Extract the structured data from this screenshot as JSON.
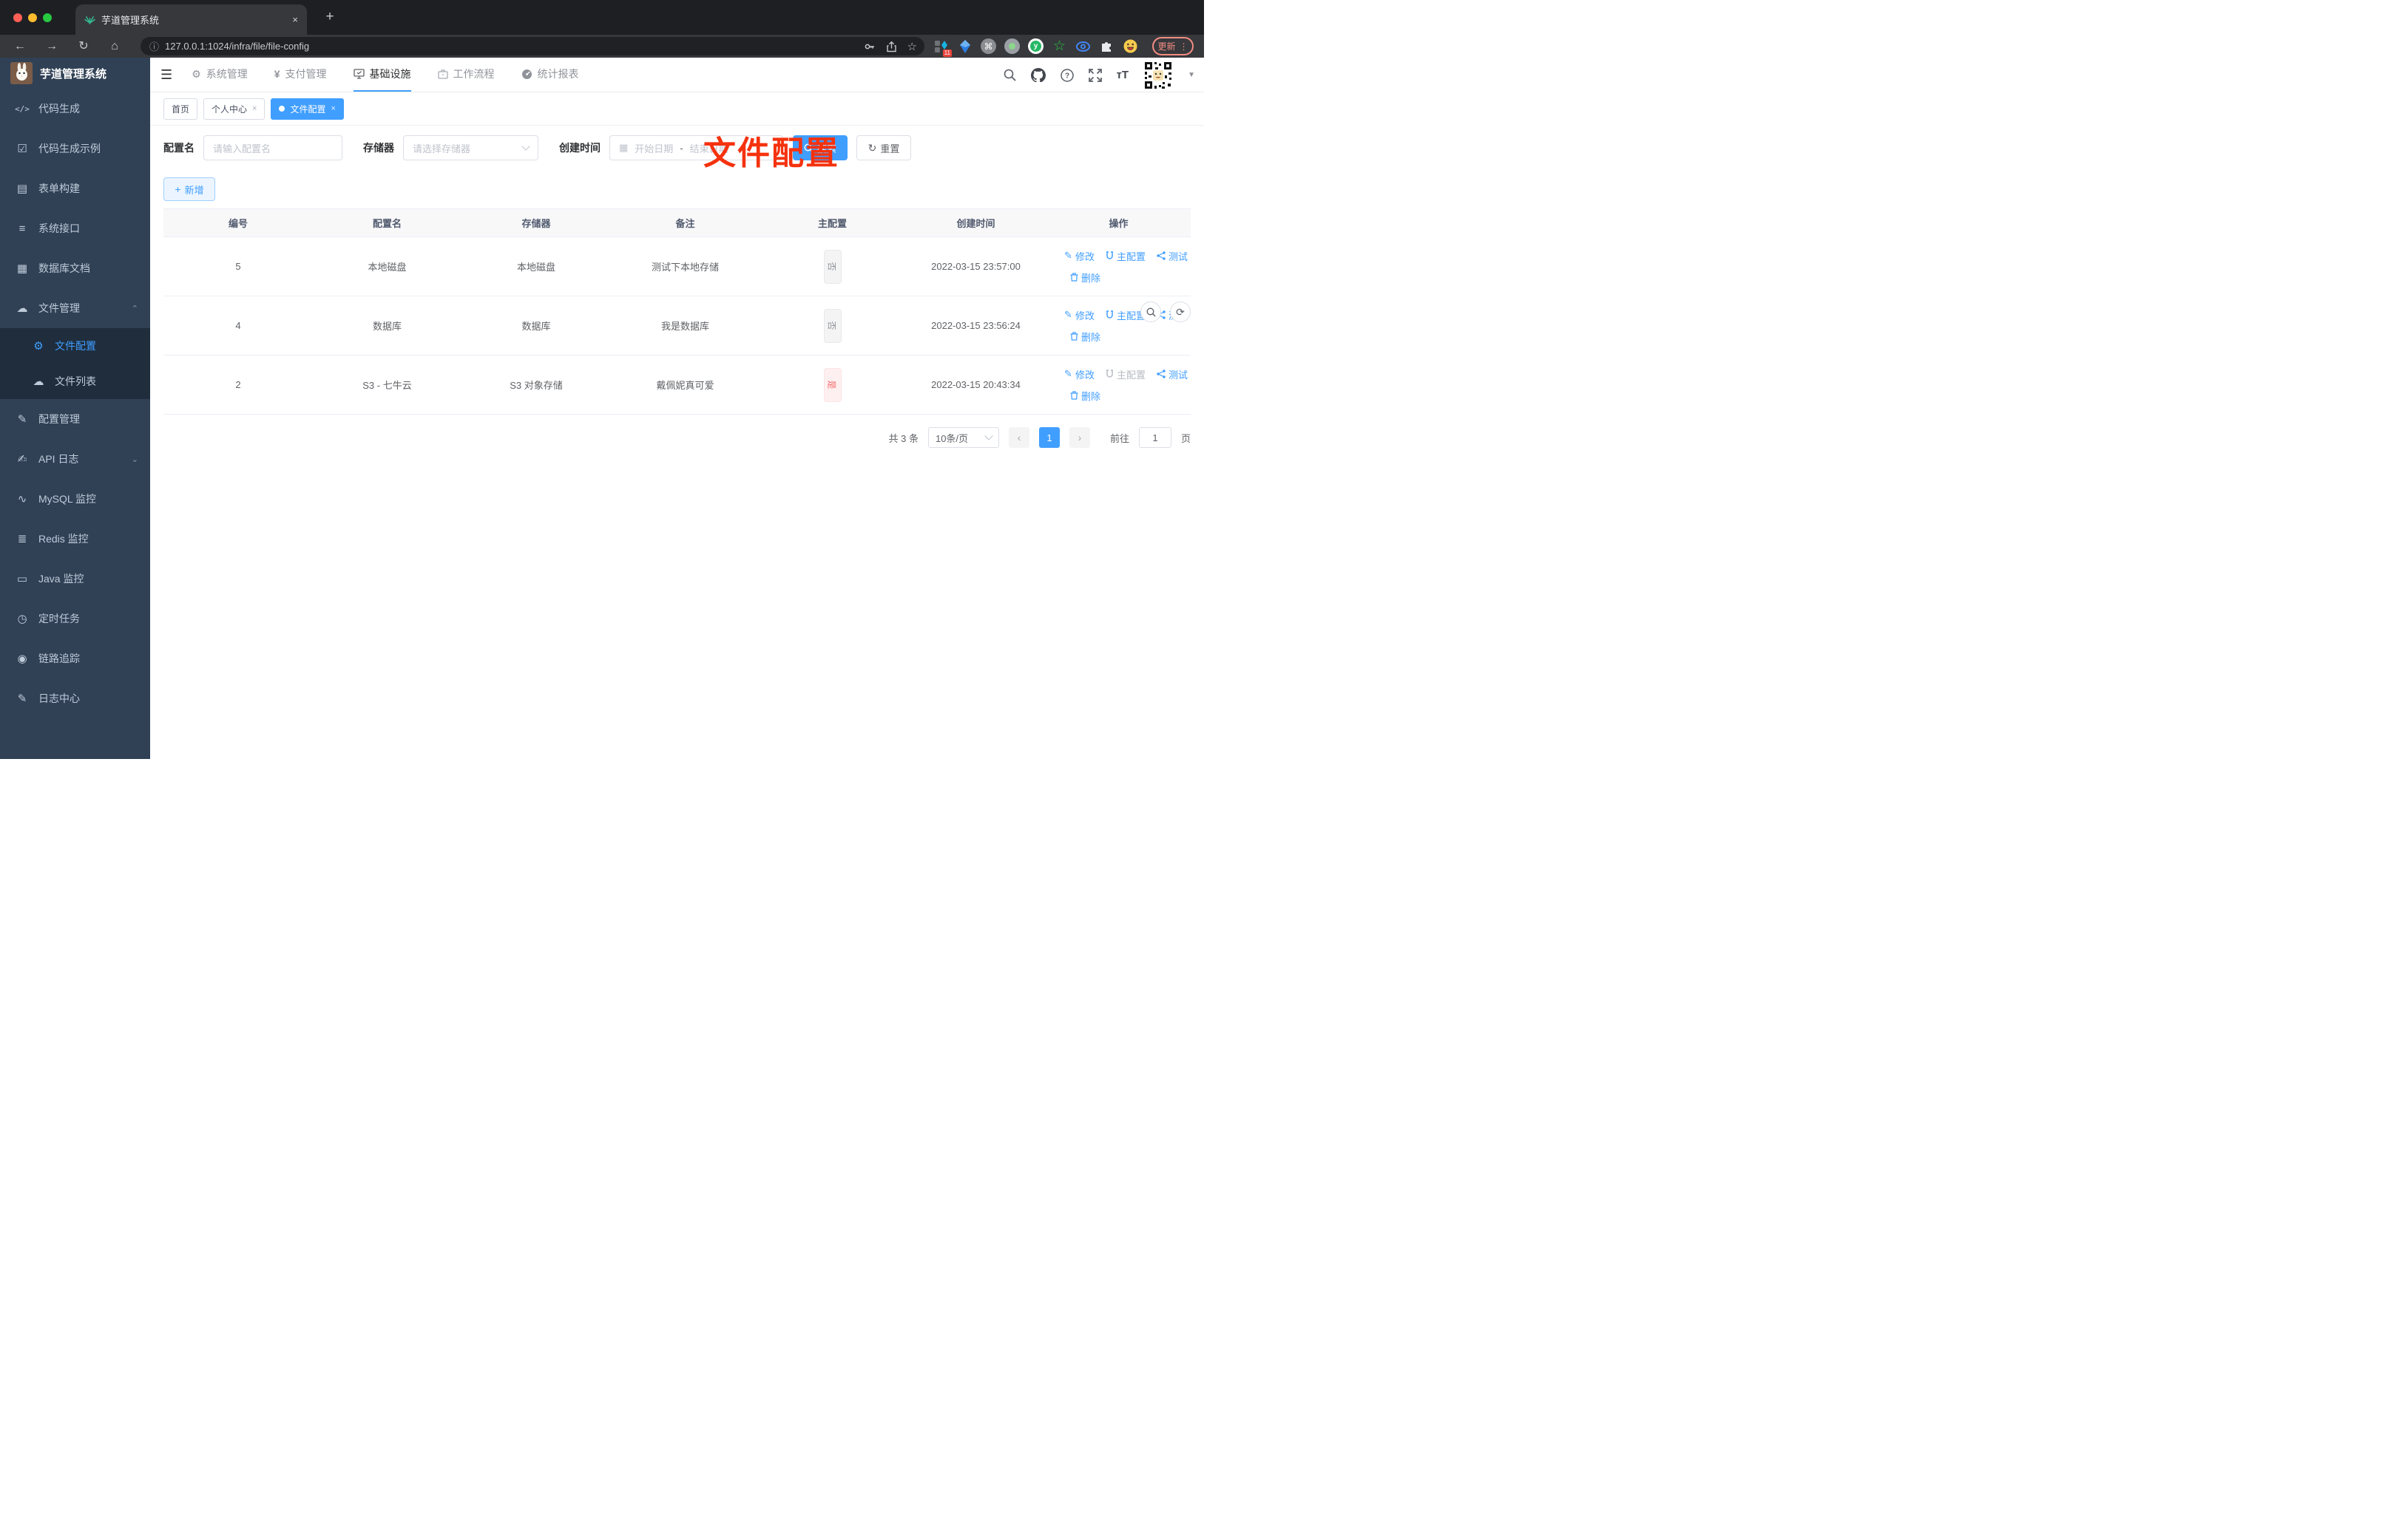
{
  "browser": {
    "tab_title": "芋道管理系统",
    "new_tab": "+",
    "close_tab": "×",
    "url": "127.0.0.1:1024/infra/file/file-config",
    "extension_badge": "11",
    "update_button": "更新"
  },
  "app": {
    "logo_title": "芋道管理系统",
    "top_nav": [
      {
        "label": "系统管理",
        "icon": "⚙"
      },
      {
        "label": "支付管理",
        "icon": "¥"
      },
      {
        "label": "基础设施",
        "icon": ""
      },
      {
        "label": "工作流程",
        "icon": ""
      },
      {
        "label": "统计报表",
        "icon": ""
      }
    ]
  },
  "sidebar": {
    "items": [
      {
        "label": "代码生成",
        "icon": "</>"
      },
      {
        "label": "代码生成示例",
        "icon": "☑"
      },
      {
        "label": "表单构建",
        "icon": "▤"
      },
      {
        "label": "系统接口",
        "icon": "≡"
      },
      {
        "label": "数据库文档",
        "icon": "▦"
      },
      {
        "label": "文件管理",
        "icon": "☁"
      },
      {
        "label": "文件配置",
        "icon": "⚙"
      },
      {
        "label": "文件列表",
        "icon": "☁"
      },
      {
        "label": "配置管理",
        "icon": "✎"
      },
      {
        "label": "API 日志",
        "icon": "✍"
      },
      {
        "label": "MySQL 监控",
        "icon": "∿"
      },
      {
        "label": "Redis 监控",
        "icon": "≣"
      },
      {
        "label": "Java 监控",
        "icon": "▭"
      },
      {
        "label": "定时任务",
        "icon": "◷"
      },
      {
        "label": "链路追踪",
        "icon": "◉"
      },
      {
        "label": "日志中心",
        "icon": "✎"
      }
    ]
  },
  "tabs": [
    {
      "label": "首页"
    },
    {
      "label": "个人中心",
      "close": "×"
    },
    {
      "label": "文件配置",
      "close": "×"
    }
  ],
  "annotation": "文件配置",
  "filter": {
    "name_label": "配置名",
    "name_placeholder": "请输入配置名",
    "storage_label": "存储器",
    "storage_placeholder": "请选择存储器",
    "time_label": "创建时间",
    "start_placeholder": "开始日期",
    "separator": "-",
    "end_placeholder": "结束日期",
    "search_label": "搜索",
    "reset_label": "重置"
  },
  "toolbar": {
    "add_label": "新增"
  },
  "table": {
    "headers": [
      "编号",
      "配置名",
      "存储器",
      "备注",
      "主配置",
      "创建时间",
      "操作"
    ],
    "actions": {
      "edit": "修改",
      "master": "主配置",
      "test": "测试",
      "delete": "删除"
    },
    "rows": [
      {
        "id": "5",
        "name": "本地磁盘",
        "storage": "本地磁盘",
        "remark": "测试下本地存储",
        "master": "否",
        "master_type": "info",
        "time": "2022-03-15 23:57:00",
        "master_action_disabled": false
      },
      {
        "id": "4",
        "name": "数据库",
        "storage": "数据库",
        "remark": "我是数据库",
        "master": "否",
        "master_type": "info",
        "time": "2022-03-15 23:56:24",
        "master_action_disabled": false
      },
      {
        "id": "2",
        "name": "S3 - 七牛云",
        "storage": "S3 对象存储",
        "remark": "戴佩妮真可爱",
        "master": "是",
        "master_type": "danger",
        "time": "2022-03-15 20:43:34",
        "master_action_disabled": true
      }
    ]
  },
  "pagination": {
    "total": "共 3 条",
    "page_size": "10条/页",
    "prev": "‹",
    "current": "1",
    "next": "›",
    "goto_label": "前往",
    "goto_value": "1",
    "page_unit": "页"
  }
}
